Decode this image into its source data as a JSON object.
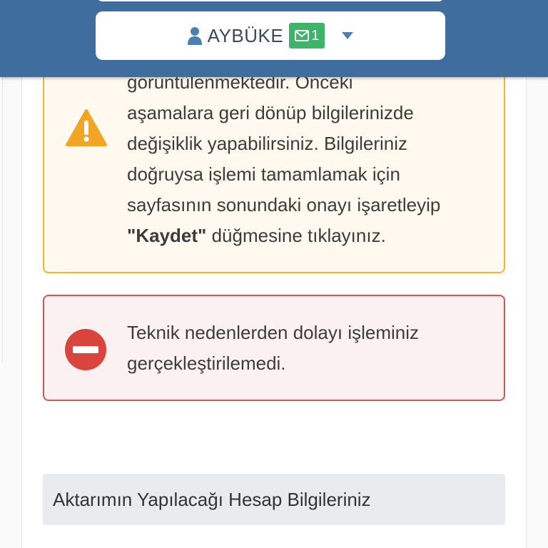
{
  "header": {
    "user_name": "AYBÜKE",
    "message_count": "1",
    "icons": {
      "user": "user-icon",
      "messages": "envelope-icon",
      "dropdown": "caret-down-icon"
    },
    "colors": {
      "bar": "#3f6e9e",
      "badge": "#3fb36a",
      "icon": "#4a80b4"
    }
  },
  "warning_alert": {
    "line_1": "görüntülenmektedir. Önceki",
    "line_2": "aşamalara geri dönüp bilgilerinizde",
    "line_3": "değişiklik yapabilirsiniz. Bilgileriniz",
    "line_4": "doğruysa işlemi tamamlamak için",
    "line_5": "sayfasının sonundaki onayı işaretleyip",
    "emphasis": "\"Kaydet\"",
    "line_6_rest": " düğmesine tıklayınız.",
    "icon": "warning-triangle-icon",
    "color": "#f0b62e"
  },
  "danger_alert": {
    "line_1": "Teknik nedenlerden dolayı işleminiz",
    "line_2": "gerçekleştirilemedi.",
    "icon": "stop-circle-icon",
    "color": "#d9453d"
  },
  "section": {
    "title": "Aktarımın Yapılacağı Hesap Bilgileriniz"
  }
}
